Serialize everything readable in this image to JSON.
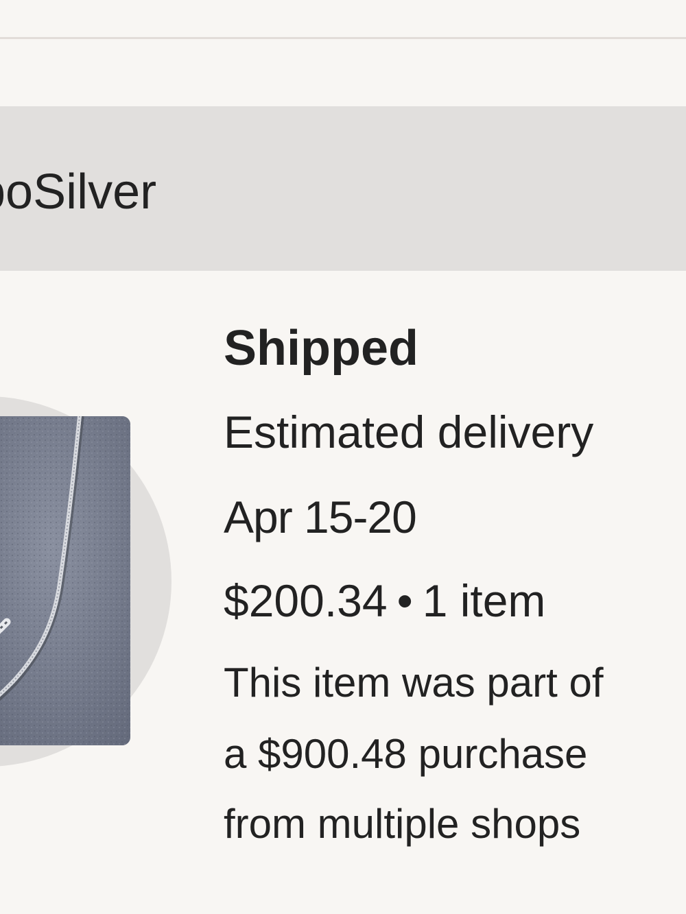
{
  "shop": {
    "name_visible": "boSilver"
  },
  "order": {
    "status": "Shipped",
    "delivery_label": "Estimated delivery",
    "delivery_dates": "Apr 15-20",
    "price": "$200.34",
    "separator": "•",
    "item_count": "1 item",
    "note_line_1": "This item was part of",
    "note_line_2": "a $900.48 purchase",
    "note_line_3": "from multiple shops"
  },
  "thumbnail": {
    "subject": "silver curb chain necklace on stone"
  },
  "colors": {
    "page_background": "#f8f6f3",
    "header_background": "#e1dfdd",
    "text": "#222222"
  }
}
